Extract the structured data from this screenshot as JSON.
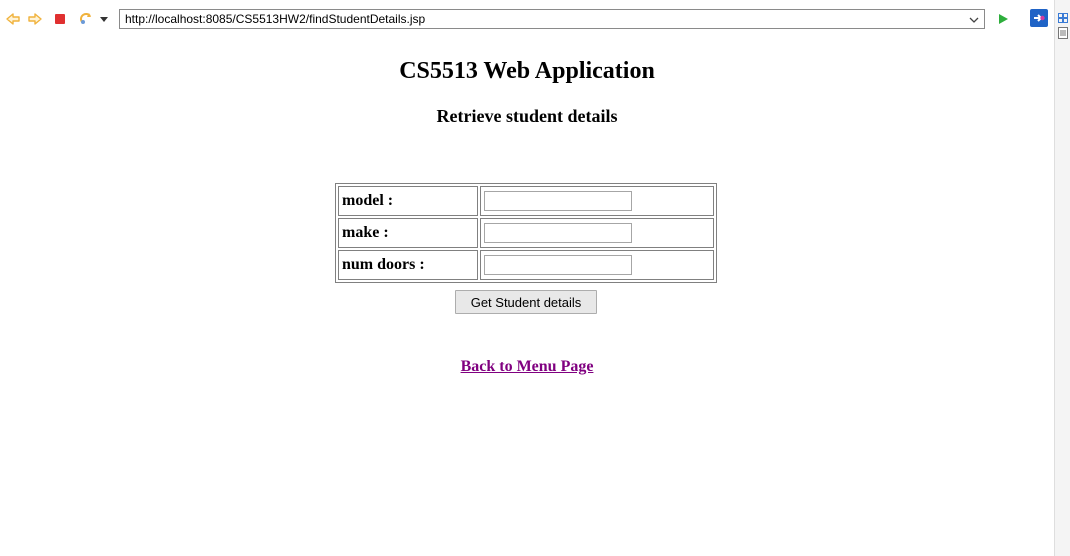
{
  "browser": {
    "url": "http://localhost:8085/CS5513HW2/findStudentDetails.jsp"
  },
  "page": {
    "title": "CS5513 Web Application",
    "subtitle": "Retrieve student details"
  },
  "form": {
    "rows": [
      {
        "label": "model :",
        "value": ""
      },
      {
        "label": "make :",
        "value": ""
      },
      {
        "label": "num doors :",
        "value": ""
      }
    ],
    "submit_label": "Get Student details"
  },
  "links": {
    "back": "Back to Menu Page"
  },
  "colors": {
    "link_visited": "#800080",
    "back_arrow": "#f0b23c",
    "stop": "#e03030",
    "go": "#2eae3c"
  }
}
